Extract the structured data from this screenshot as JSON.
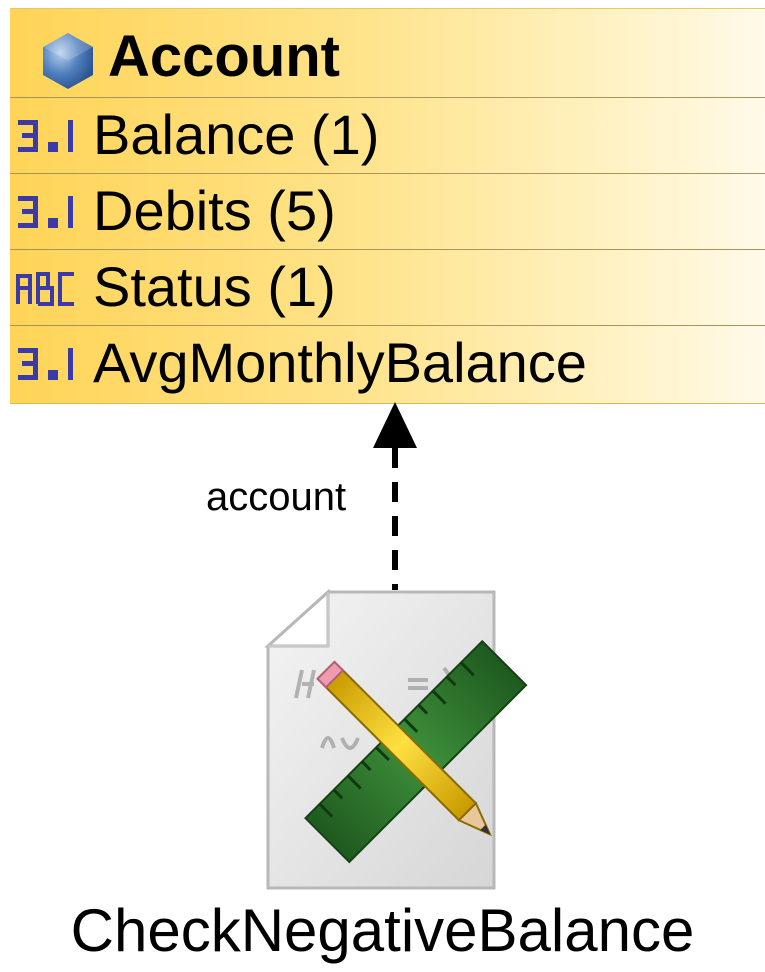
{
  "entity": {
    "name": "Account",
    "icon": "entity-hexagon-icon",
    "attributes": [
      {
        "label": "Balance (1)",
        "type_icon": "numeric-type-icon"
      },
      {
        "label": "Debits (5)",
        "type_icon": "numeric-type-icon"
      },
      {
        "label": "Status (1)",
        "type_icon": "text-type-icon"
      },
      {
        "label": "AvgMonthlyBalance",
        "type_icon": "numeric-type-icon"
      }
    ]
  },
  "relationship": {
    "label": "account",
    "style": "dashed-arrow"
  },
  "rule": {
    "name": "CheckNegativeBalance",
    "icon": "formula-document-icon"
  },
  "colors": {
    "entity_fill_start": "#ffd457",
    "entity_fill_end": "#fffaea",
    "row_divider": "#a8955c",
    "type_icon": "#3a3aa8",
    "ruler_green": "#2f7a2f",
    "pencil_yellow": "#f2c200"
  }
}
